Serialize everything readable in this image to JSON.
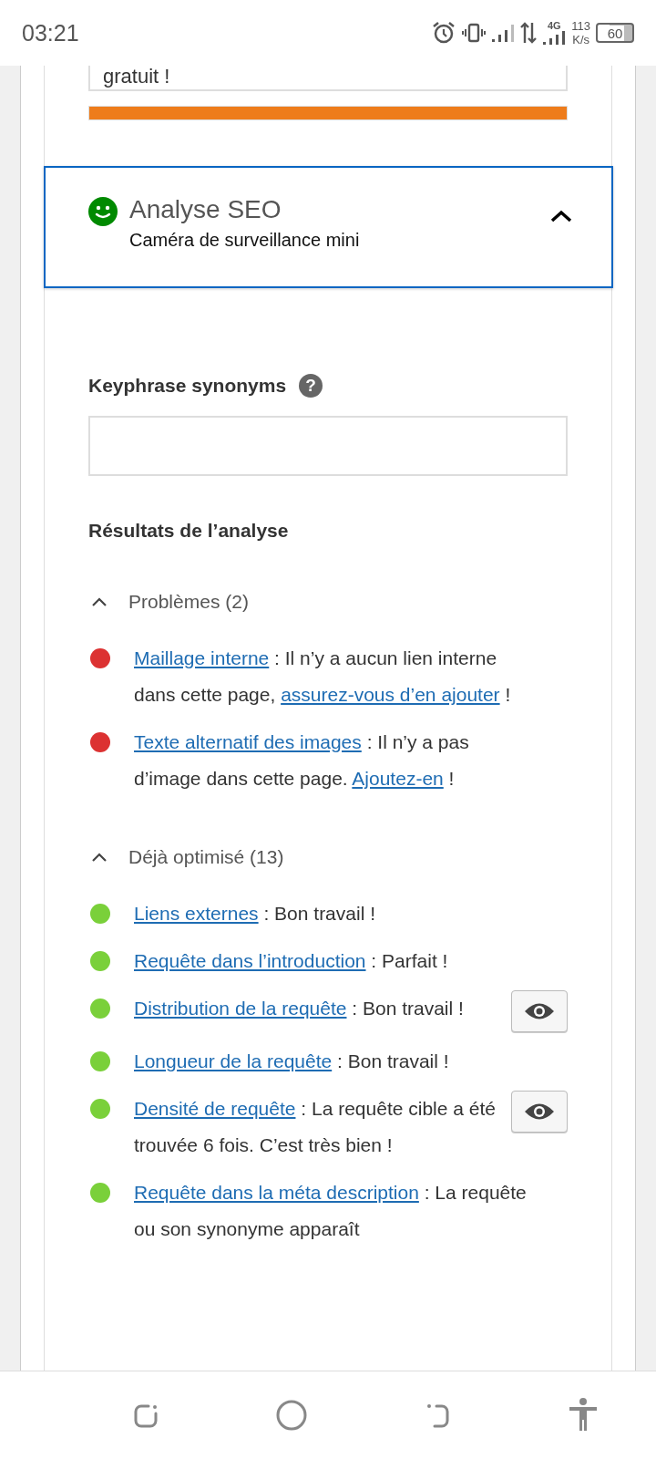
{
  "status_bar": {
    "time": "03:21",
    "network_type": "4G",
    "speed_value": "113",
    "speed_unit": "K/s",
    "battery": "60"
  },
  "meta_field": {
    "value": "gratuit !"
  },
  "length_bar": {
    "level": 1
  },
  "seo_panel": {
    "title": "Analyse SEO",
    "subtitle": "Caméra de surveillance mini",
    "expanded": true
  },
  "synonyms": {
    "label": "Keyphrase synonyms",
    "help": "?"
  },
  "results_heading": "Résultats de l’analyse",
  "groups": [
    {
      "title": "Problèmes (2)",
      "expanded": true,
      "items": [
        {
          "color": "#dc3232",
          "eye_button": false,
          "segments": [
            {
              "text": "Maillage interne",
              "link": true
            },
            {
              "text": " : Il n’y a aucun lien interne dans cette page, ",
              "link": false
            },
            {
              "text": "assurez-vous d’en ajouter",
              "link": true
            },
            {
              "text": " !",
              "link": false
            }
          ]
        },
        {
          "color": "#dc3232",
          "eye_button": false,
          "segments": [
            {
              "text": "Texte alternatif des images",
              "link": true
            },
            {
              "text": " : Il n’y a pas d’image dans cette page. ",
              "link": false
            },
            {
              "text": "Ajoutez-en",
              "link": true
            },
            {
              "text": " !",
              "link": false
            }
          ]
        }
      ]
    },
    {
      "title": "Déjà optimisé (13)",
      "expanded": true,
      "items": [
        {
          "color": "#7ad03a",
          "eye_button": false,
          "segments": [
            {
              "text": "Liens externes",
              "link": true
            },
            {
              "text": " : Bon travail !",
              "link": false
            }
          ]
        },
        {
          "color": "#7ad03a",
          "eye_button": false,
          "segments": [
            {
              "text": "Requête dans l’introduction",
              "link": true
            },
            {
              "text": " : Parfait !",
              "link": false
            }
          ]
        },
        {
          "color": "#7ad03a",
          "eye_button": true,
          "segments": [
            {
              "text": "Distribution de la requête",
              "link": true
            },
            {
              "text": " : Bon travail !",
              "link": false
            }
          ]
        },
        {
          "color": "#7ad03a",
          "eye_button": false,
          "segments": [
            {
              "text": "Longueur de la requête",
              "link": true
            },
            {
              "text": " : Bon travail !",
              "link": false
            }
          ]
        },
        {
          "color": "#7ad03a",
          "eye_button": true,
          "segments": [
            {
              "text": "Densité de requête",
              "link": true
            },
            {
              "text": " : La requête cible a été trouvée 6 fois. C’est très bien !",
              "link": false
            }
          ]
        },
        {
          "color": "#7ad03a",
          "eye_button": false,
          "segments": [
            {
              "text": "Requête dans la méta description",
              "link": true
            },
            {
              "text": " : La requête ou son synonyme apparaît",
              "link": false
            }
          ]
        }
      ]
    }
  ]
}
